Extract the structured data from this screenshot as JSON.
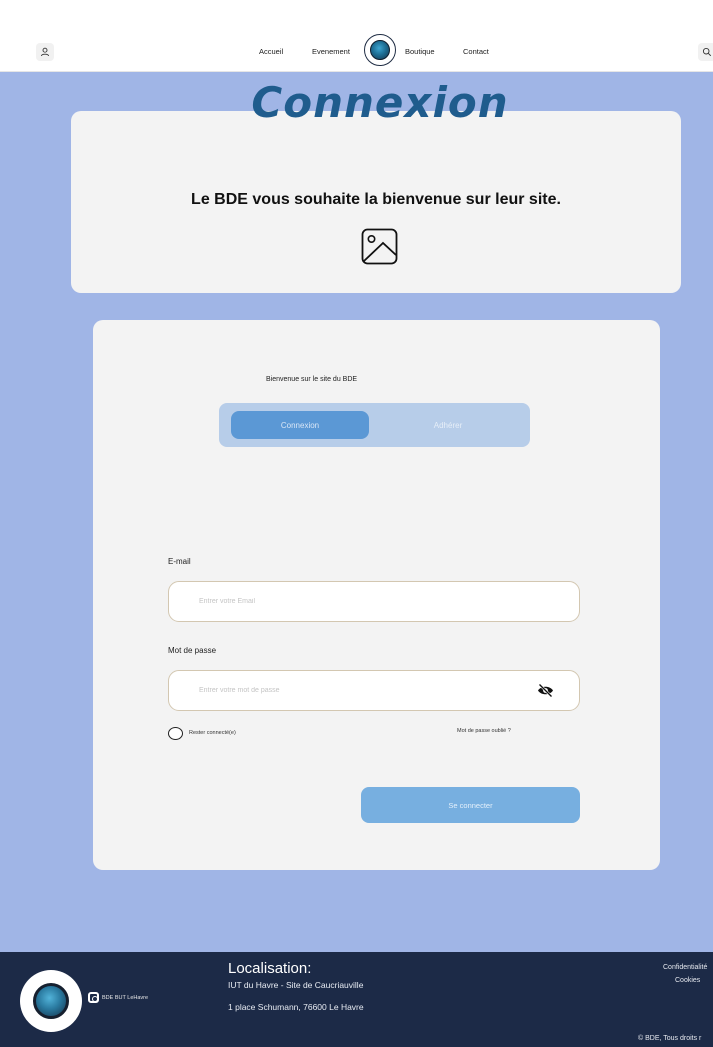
{
  "header": {
    "nav": [
      "Accueil",
      "Evenement",
      "Boutique",
      "Contact"
    ],
    "icons": {
      "left": "user-icon",
      "right": "search-icon",
      "center": "bde-logo"
    }
  },
  "main": {
    "page_title": "Connexion",
    "welcome_text": "Le BDE vous souhaite la bienvenue sur leur site.",
    "welcome_icon": "image-placeholder-icon"
  },
  "form": {
    "subtitle": "Bienvenue sur le site du BDE",
    "tabs": {
      "active": "Connexion",
      "inactive": "Adhérer"
    },
    "email_label": "E-mail",
    "email_placeholder": "Entrer votre Email",
    "password_label": "Mot de passe",
    "password_placeholder": "Entrer votre mot de passe",
    "remember_label": "Rester connecté(e)",
    "forgot_label": "Mot de passe oublié ?",
    "submit_label": "Se connecter"
  },
  "footer": {
    "instagram_label": "BDE BUT LeHavre",
    "location_title": "Localisation:",
    "location_line1": "IUT du Havre - Site de Caucriauville",
    "location_line2": "1 place Schumann, 76600 Le Havre",
    "privacy": "Confidentialité",
    "cookies": "Cookies",
    "copyright": "© BDE, Tous droits r"
  },
  "colors": {
    "page_background": "#a0b5e6",
    "title": "#1f5c8d",
    "tab_active": "#5b98d5",
    "submit": "#77afe0",
    "footer": "#1c2a47"
  }
}
